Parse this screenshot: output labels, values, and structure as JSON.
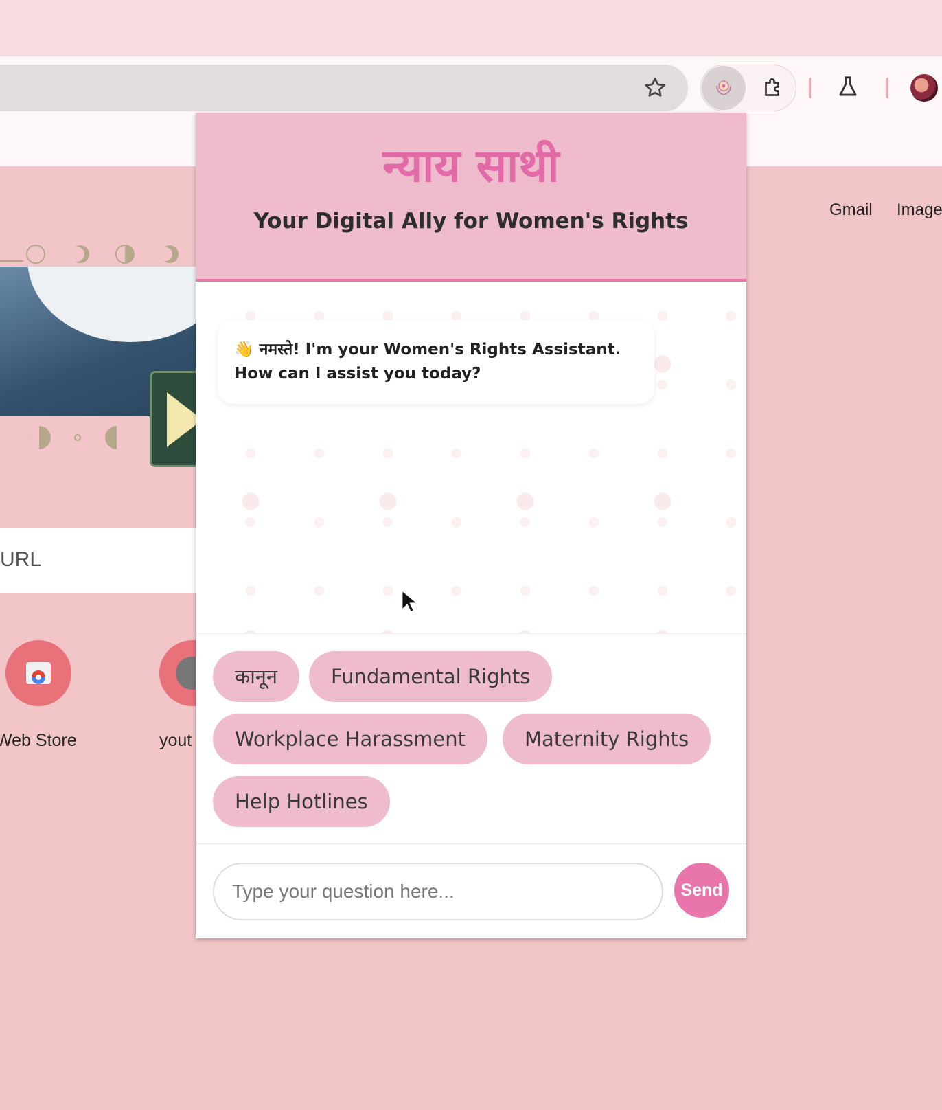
{
  "browser": {
    "omnibox_icons": [
      "star-icon"
    ],
    "extension_icons": [
      "nyay-saathi-logo-icon",
      "puzzle-icon",
      "flask-icon"
    ]
  },
  "new_tab_page": {
    "links": [
      "Gmail",
      "Image"
    ],
    "search_placeholder": "URL",
    "shortcuts": [
      {
        "label": "Web Store"
      },
      {
        "label": "yout"
      }
    ]
  },
  "popup": {
    "title": "न्याय साथी",
    "subtitle": "Your Digital Ally for Women's Rights",
    "messages": [
      {
        "sender": "bot",
        "text": "👋 नमस्ते! I'm your Women's Rights Assistant. How can I assist you today?"
      }
    ],
    "quick_topics": [
      "कानून",
      "Fundamental Rights",
      "Workplace Harassment",
      "Maternity Rights",
      "Help Hotlines"
    ],
    "input": {
      "placeholder": "Type your question here...",
      "value": ""
    },
    "send_label": "Send",
    "colors": {
      "accent": "#e876ad",
      "header_bg": "#efbccd",
      "title": "#e26aa6"
    }
  }
}
